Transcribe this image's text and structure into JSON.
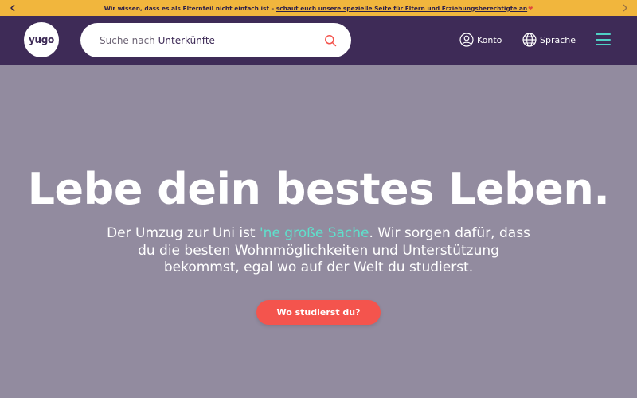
{
  "banner": {
    "text": "Wir wissen, dass es als Elternteil nicht einfach ist – ",
    "link": "schaut euch unsere spezielle Seite für Eltern und Erziehungsberechtigte an",
    "heart": "❤",
    "background": "#f1b63d"
  },
  "nav": {
    "logo": "yugo",
    "search_placeholder_prefix": "Suche nach ",
    "search_placeholder_term": "Unterkünfte",
    "account_label": "Konto",
    "language_label": "Sprache",
    "icons": [
      "user-icon",
      "globe-icon",
      "search-icon",
      "hamburger-menu-icon"
    ],
    "background": "#3e2b57",
    "accent": "#4fd1c5"
  },
  "hero": {
    "title": "Lebe dein bestes Leben.",
    "text_part1": "Der Umzug zur Uni ist ",
    "text_highlight": "'ne große Sache",
    "text_part2": ". Wir sorgen dafür, dass du die besten Wohnmöglichkeiten und Unterstützung bekommst, egal wo auf der Welt du studierst.",
    "cta": "Wo studierst du?",
    "highlight_color": "#5fe0cc",
    "cta_color": "#f4544d"
  }
}
